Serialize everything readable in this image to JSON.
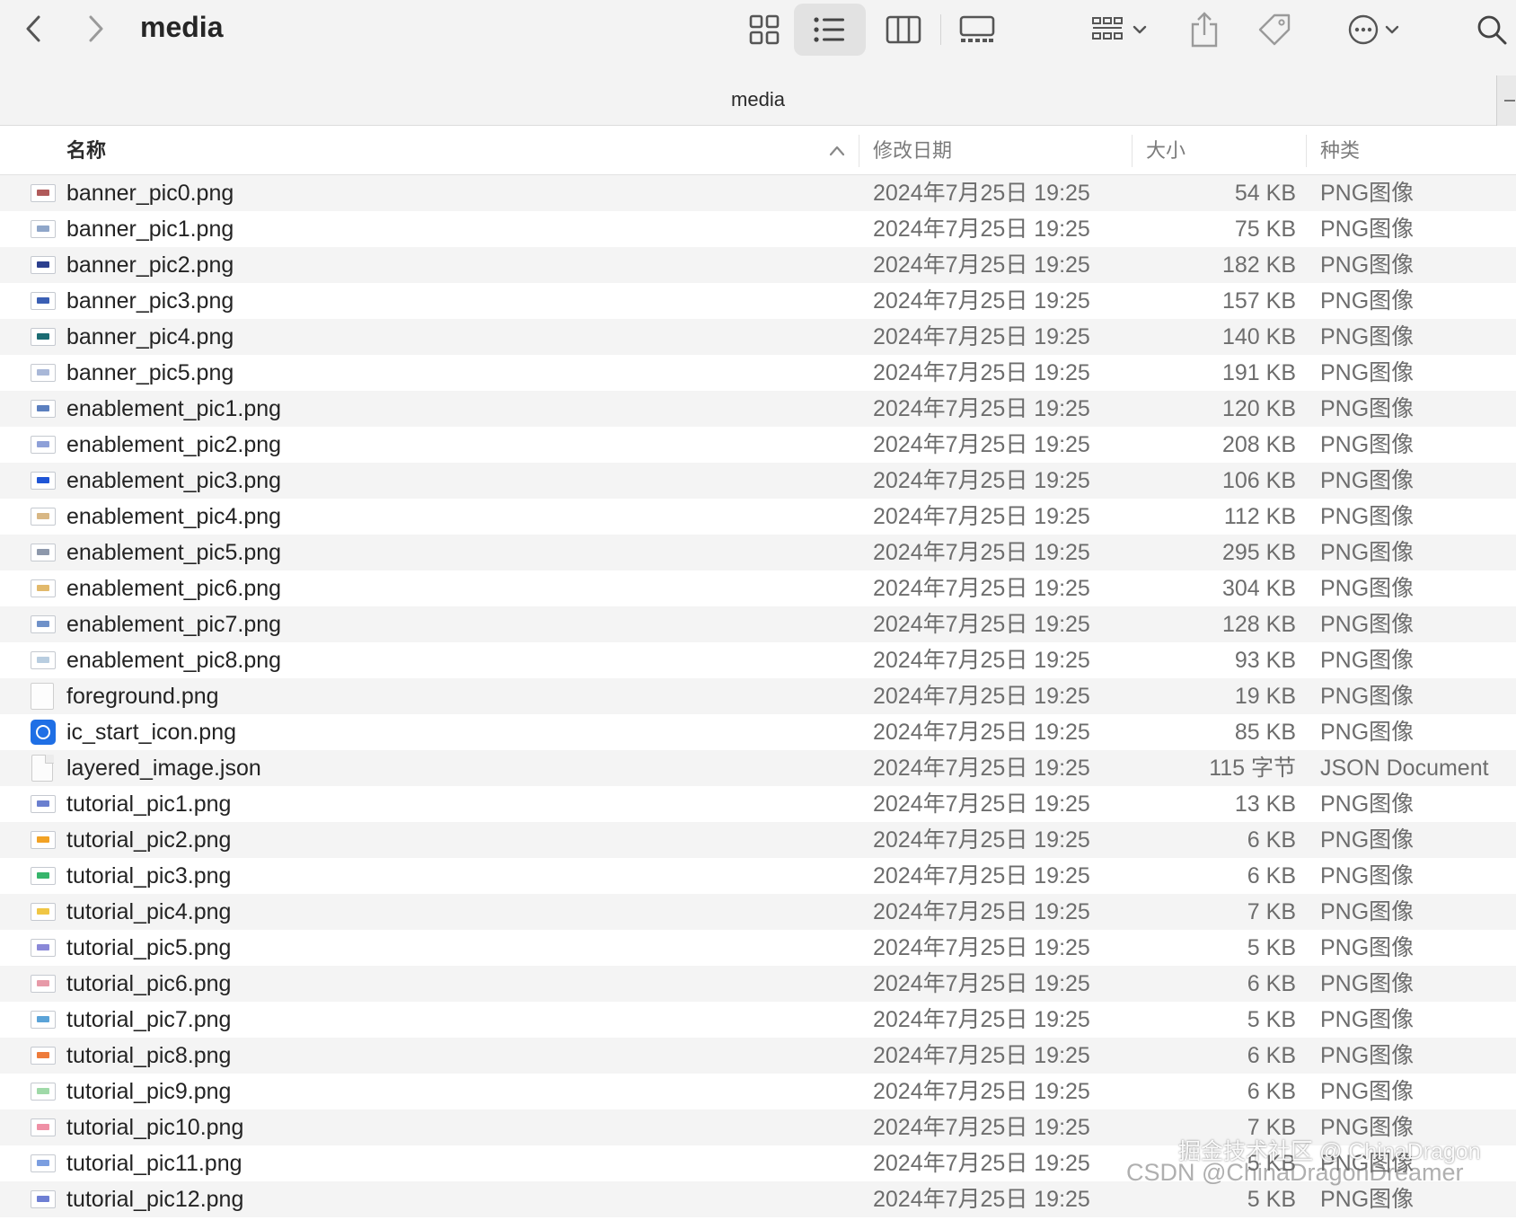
{
  "window": {
    "title": "media",
    "path_title": "media"
  },
  "toolbar": {
    "icons": [
      "chevron-left-icon",
      "chevron-right-icon",
      "grid-view-icon",
      "list-view-icon",
      "column-view-icon",
      "gallery-view-icon",
      "group-icon",
      "share-icon",
      "tag-icon",
      "more-icon",
      "search-icon"
    ],
    "active_view": "list"
  },
  "columns": {
    "name": "名称",
    "date": "修改日期",
    "size": "大小",
    "kind": "种类"
  },
  "files": [
    {
      "name": "banner_pic0.png",
      "date": "2024年7月25日 19:25",
      "size": "54 KB",
      "kind": "PNG图像",
      "icon": "image",
      "color": "#b05a5a"
    },
    {
      "name": "banner_pic1.png",
      "date": "2024年7月25日 19:25",
      "size": "75 KB",
      "kind": "PNG图像",
      "icon": "image",
      "color": "#8fa6c9"
    },
    {
      "name": "banner_pic2.png",
      "date": "2024年7月25日 19:25",
      "size": "182 KB",
      "kind": "PNG图像",
      "icon": "image",
      "color": "#2b3f8e"
    },
    {
      "name": "banner_pic3.png",
      "date": "2024年7月25日 19:25",
      "size": "157 KB",
      "kind": "PNG图像",
      "icon": "image",
      "color": "#3a5fb4"
    },
    {
      "name": "banner_pic4.png",
      "date": "2024年7月25日 19:25",
      "size": "140 KB",
      "kind": "PNG图像",
      "icon": "image",
      "color": "#1b6c73"
    },
    {
      "name": "banner_pic5.png",
      "date": "2024年7月25日 19:25",
      "size": "191 KB",
      "kind": "PNG图像",
      "icon": "image",
      "color": "#a9b8d8"
    },
    {
      "name": "enablement_pic1.png",
      "date": "2024年7月25日 19:25",
      "size": "120 KB",
      "kind": "PNG图像",
      "icon": "image",
      "color": "#5b7fbf"
    },
    {
      "name": "enablement_pic2.png",
      "date": "2024年7月25日 19:25",
      "size": "208 KB",
      "kind": "PNG图像",
      "icon": "image",
      "color": "#8ea0d8"
    },
    {
      "name": "enablement_pic3.png",
      "date": "2024年7月25日 19:25",
      "size": "106 KB",
      "kind": "PNG图像",
      "icon": "image",
      "color": "#1f55d6"
    },
    {
      "name": "enablement_pic4.png",
      "date": "2024年7月25日 19:25",
      "size": "112 KB",
      "kind": "PNG图像",
      "icon": "image",
      "color": "#d8b784"
    },
    {
      "name": "enablement_pic5.png",
      "date": "2024年7月25日 19:25",
      "size": "295 KB",
      "kind": "PNG图像",
      "icon": "image",
      "color": "#8d98ab"
    },
    {
      "name": "enablement_pic6.png",
      "date": "2024年7月25日 19:25",
      "size": "304 KB",
      "kind": "PNG图像",
      "icon": "image",
      "color": "#e2b96b"
    },
    {
      "name": "enablement_pic7.png",
      "date": "2024年7月25日 19:25",
      "size": "128 KB",
      "kind": "PNG图像",
      "icon": "image",
      "color": "#6f91c9"
    },
    {
      "name": "enablement_pic8.png",
      "date": "2024年7月25日 19:25",
      "size": "93 KB",
      "kind": "PNG图像",
      "icon": "image",
      "color": "#b8cde0"
    },
    {
      "name": "foreground.png",
      "date": "2024年7月25日 19:25",
      "size": "19 KB",
      "kind": "PNG图像",
      "icon": "blank",
      "color": "#ffffff"
    },
    {
      "name": "ic_start_icon.png",
      "date": "2024年7月25日 19:25",
      "size": "85 KB",
      "kind": "PNG图像",
      "icon": "app",
      "color": "#1f6fe5"
    },
    {
      "name": "layered_image.json",
      "date": "2024年7月25日 19:25",
      "size": "115 字节",
      "kind": "JSON Document",
      "icon": "doc",
      "color": "#ececec"
    },
    {
      "name": "tutorial_pic1.png",
      "date": "2024年7月25日 19:25",
      "size": "13 KB",
      "kind": "PNG图像",
      "icon": "image",
      "color": "#6a7fcf"
    },
    {
      "name": "tutorial_pic2.png",
      "date": "2024年7月25日 19:25",
      "size": "6 KB",
      "kind": "PNG图像",
      "icon": "image",
      "color": "#f2a224"
    },
    {
      "name": "tutorial_pic3.png",
      "date": "2024年7月25日 19:25",
      "size": "6 KB",
      "kind": "PNG图像",
      "icon": "image",
      "color": "#36b56b"
    },
    {
      "name": "tutorial_pic4.png",
      "date": "2024年7月25日 19:25",
      "size": "7 KB",
      "kind": "PNG图像",
      "icon": "image",
      "color": "#f0c644"
    },
    {
      "name": "tutorial_pic5.png",
      "date": "2024年7月25日 19:25",
      "size": "5 KB",
      "kind": "PNG图像",
      "icon": "image",
      "color": "#8a88d8"
    },
    {
      "name": "tutorial_pic6.png",
      "date": "2024年7月25日 19:25",
      "size": "6 KB",
      "kind": "PNG图像",
      "icon": "image",
      "color": "#e79aa8"
    },
    {
      "name": "tutorial_pic7.png",
      "date": "2024年7月25日 19:25",
      "size": "5 KB",
      "kind": "PNG图像",
      "icon": "image",
      "color": "#5aa3d8"
    },
    {
      "name": "tutorial_pic8.png",
      "date": "2024年7月25日 19:25",
      "size": "6 KB",
      "kind": "PNG图像",
      "icon": "image",
      "color": "#ee7b3b"
    },
    {
      "name": "tutorial_pic9.png",
      "date": "2024年7月25日 19:25",
      "size": "6 KB",
      "kind": "PNG图像",
      "icon": "image",
      "color": "#9fd9a8"
    },
    {
      "name": "tutorial_pic10.png",
      "date": "2024年7月25日 19:25",
      "size": "7 KB",
      "kind": "PNG图像",
      "icon": "image",
      "color": "#ef8fa5"
    },
    {
      "name": "tutorial_pic11.png",
      "date": "2024年7月25日 19:25",
      "size": "5 KB",
      "kind": "PNG图像",
      "icon": "image",
      "color": "#7b9ee0"
    },
    {
      "name": "tutorial_pic12.png",
      "date": "2024年7月25日 19:25",
      "size": "5 KB",
      "kind": "PNG图像",
      "icon": "image",
      "color": "#6e7fd4"
    }
  ],
  "watermark": {
    "line1": "掘金技术社区 @ ChinaDragon",
    "line2": "CSDN @ChinaDragonDreamer"
  }
}
